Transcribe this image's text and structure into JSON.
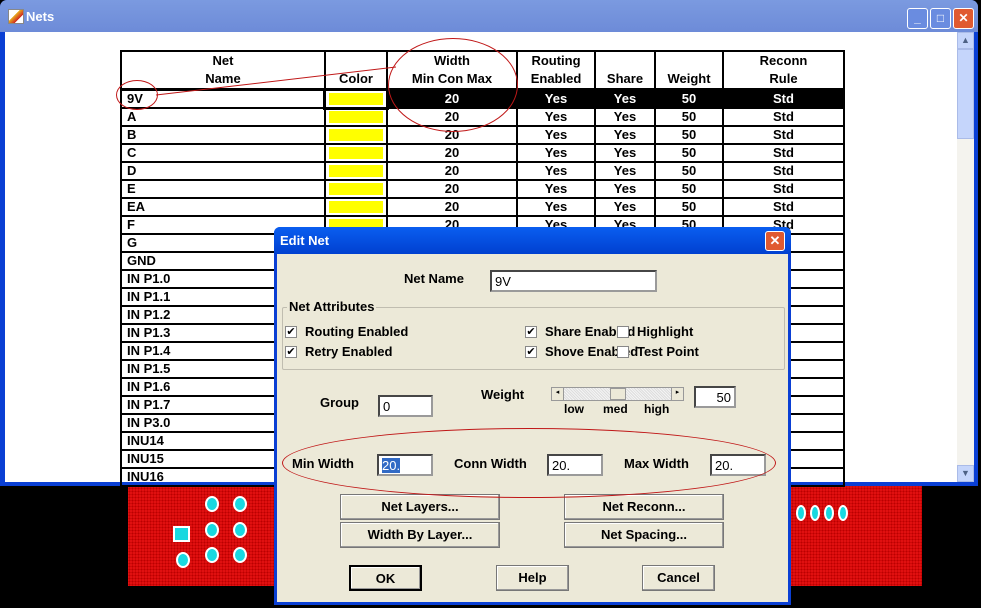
{
  "window": {
    "title": "Nets",
    "buttons": {
      "minimize": "_",
      "maximize": "□",
      "close": "✕"
    }
  },
  "table": {
    "headers": [
      [
        "Net",
        "Name"
      ],
      [
        "",
        "Color"
      ],
      [
        "Width",
        "Min Con Max"
      ],
      [
        "Routing",
        "Enabled"
      ],
      [
        "",
        "Share"
      ],
      [
        "",
        "Weight"
      ],
      [
        "Reconn",
        "Rule"
      ]
    ],
    "rows": [
      {
        "name": "9V",
        "width": "20",
        "routing": "Yes",
        "share": "Yes",
        "weight": "50",
        "rule": "Std",
        "selected": true
      },
      {
        "name": "A",
        "width": "20",
        "routing": "Yes",
        "share": "Yes",
        "weight": "50",
        "rule": "Std"
      },
      {
        "name": "B",
        "width": "20",
        "routing": "Yes",
        "share": "Yes",
        "weight": "50",
        "rule": "Std"
      },
      {
        "name": "C",
        "width": "20",
        "routing": "Yes",
        "share": "Yes",
        "weight": "50",
        "rule": "Std"
      },
      {
        "name": "D",
        "width": "20",
        "routing": "Yes",
        "share": "Yes",
        "weight": "50",
        "rule": "Std"
      },
      {
        "name": "E",
        "width": "20",
        "routing": "Yes",
        "share": "Yes",
        "weight": "50",
        "rule": "Std"
      },
      {
        "name": "EA",
        "width": "20",
        "routing": "Yes",
        "share": "Yes",
        "weight": "50",
        "rule": "Std"
      },
      {
        "name": "F",
        "width": "20",
        "routing": "Yes",
        "share": "Yes",
        "weight": "50",
        "rule": "Std"
      },
      {
        "name": "G"
      },
      {
        "name": "GND"
      },
      {
        "name": "IN P1.0"
      },
      {
        "name": "IN P1.1"
      },
      {
        "name": "IN P1.2"
      },
      {
        "name": "IN P1.3"
      },
      {
        "name": "IN P1.4"
      },
      {
        "name": "IN P1.5"
      },
      {
        "name": "IN P1.6"
      },
      {
        "name": "IN P1.7"
      },
      {
        "name": "IN P3.0"
      },
      {
        "name": "INU14"
      },
      {
        "name": "INU15"
      },
      {
        "name": "INU16"
      }
    ],
    "swatch_color": "#ffff00"
  },
  "dialog": {
    "title": "Edit Net",
    "net_name_label": "Net Name",
    "net_name": "9V",
    "attributes_label": "Net Attributes",
    "checkboxes": [
      {
        "label": "Routing Enabled",
        "checked": true
      },
      {
        "label": "Share Enabled",
        "checked": true
      },
      {
        "label": "Highlight",
        "checked": false
      },
      {
        "label": "Retry Enabled",
        "checked": true
      },
      {
        "label": "Shove Enabled",
        "checked": true
      },
      {
        "label": "Test Point",
        "checked": false
      }
    ],
    "group_label": "Group",
    "group": "0",
    "weight_label": "Weight",
    "weight": "50",
    "weight_ticks": [
      "low",
      "med",
      "high"
    ],
    "weight_level": 0.5,
    "min_width_label": "Min Width",
    "min_width": "20.",
    "conn_width_label": "Conn Width",
    "conn_width": "20.",
    "max_width_label": "Max Width",
    "max_width": "20.",
    "buttons": {
      "net_layers": "Net Layers...",
      "net_reconn": "Net Reconn...",
      "width_by_layer": "Width By Layer...",
      "net_spacing": "Net Spacing...",
      "ok": "OK",
      "help": "Help",
      "cancel": "Cancel"
    }
  }
}
